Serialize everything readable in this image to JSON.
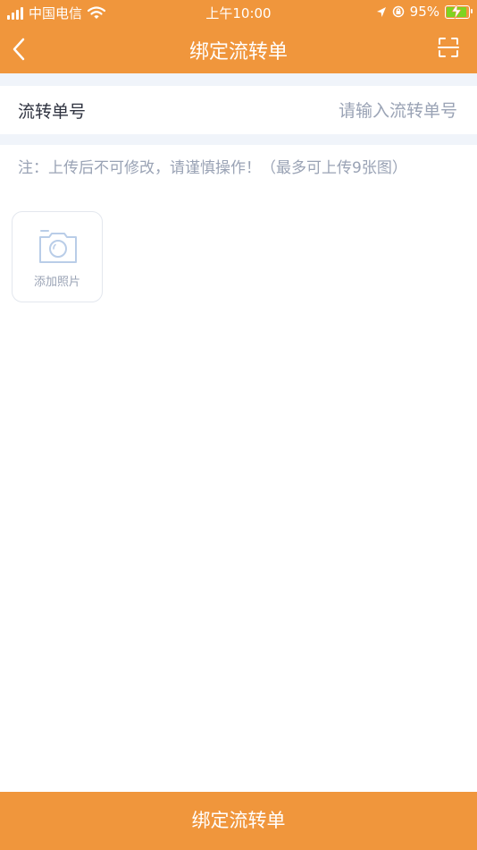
{
  "status_bar": {
    "carrier": "中国电信",
    "time": "上午10:00",
    "battery_percent": "95%",
    "battery_level": 0.95,
    "icons": [
      "signal-icon",
      "wifi-icon",
      "location-icon",
      "orientation-lock-icon",
      "battery-icon"
    ]
  },
  "nav": {
    "title": "绑定流转单",
    "back_icon": "chevron-left-icon",
    "scan_icon": "scan-icon"
  },
  "form": {
    "label": "流转单号",
    "value": "",
    "placeholder": "请输入流转单号"
  },
  "note": "注：上传后不可修改，请谨慎操作！（最多可上传9张图）",
  "upload": {
    "icon": "camera-icon",
    "label": "添加照片"
  },
  "submit_label": "绑定流转单",
  "colors": {
    "accent": "#f0963c",
    "page_bg": "#ffffff",
    "section_gap": "#f0f4fa",
    "hint_text": "#9aa3b5",
    "body_text": "#2f3340"
  }
}
